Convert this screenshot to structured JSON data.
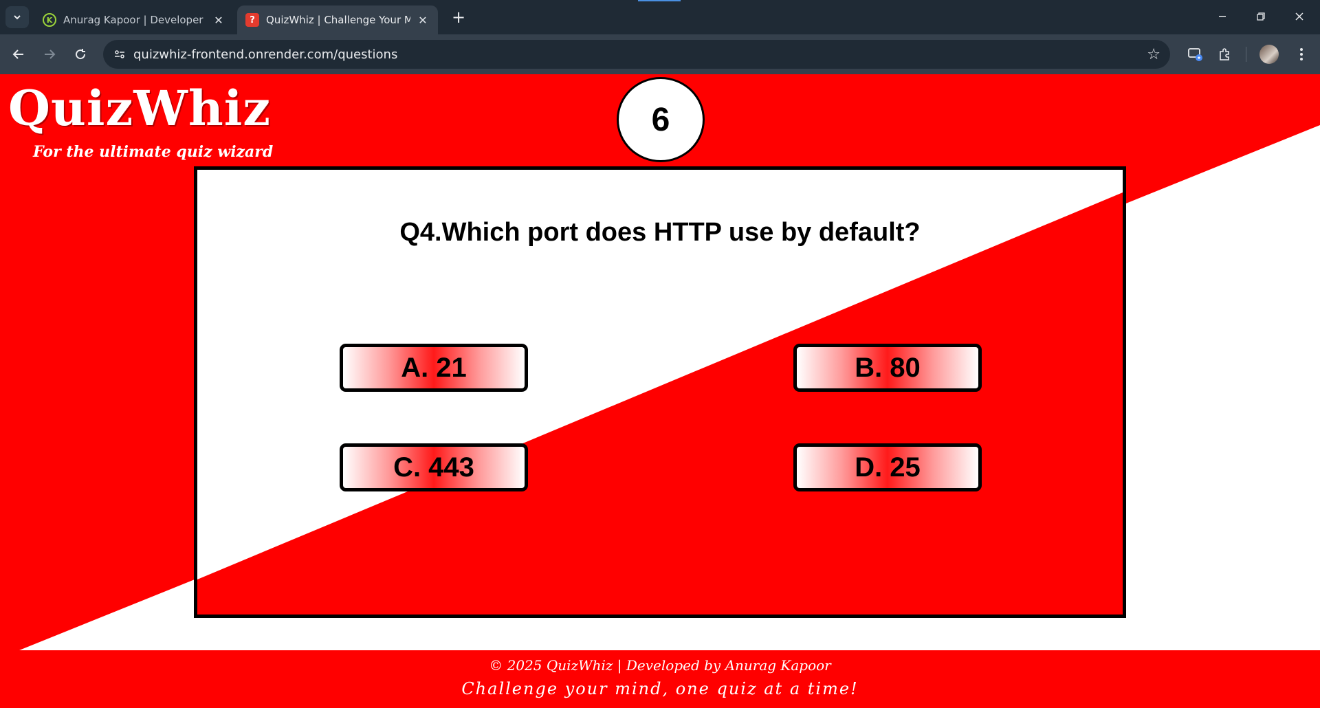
{
  "browser": {
    "tabs": [
      {
        "title": "Anurag Kapoor | Developer",
        "favicon": "leaf-logo-icon",
        "active": false
      },
      {
        "title": "QuizWhiz | Challenge Your Mind",
        "favicon": "question-mark-icon",
        "active": true
      }
    ],
    "new_tab_label": "+",
    "address": "quizwhiz-frontend.onrender.com/questions",
    "accent_color": "#1f2a35"
  },
  "brand": {
    "logo_text": "QuizWhiz",
    "tagline": "For the ultimate quiz wizard"
  },
  "timer": {
    "value": "6"
  },
  "quiz": {
    "question": "Q4.Which port does HTTP use by default?",
    "options": [
      {
        "label": "A. 21"
      },
      {
        "label": "B. 80"
      },
      {
        "label": "C. 443"
      },
      {
        "label": "D. 25"
      }
    ]
  },
  "footer": {
    "copyright": "© 2025 QuizWhiz | Developed by Anurag Kapoor",
    "slogan": "Challenge your mind, one quiz at a time!"
  },
  "colors": {
    "primary_red": "#ff0000",
    "white": "#ffffff",
    "black": "#000000"
  }
}
